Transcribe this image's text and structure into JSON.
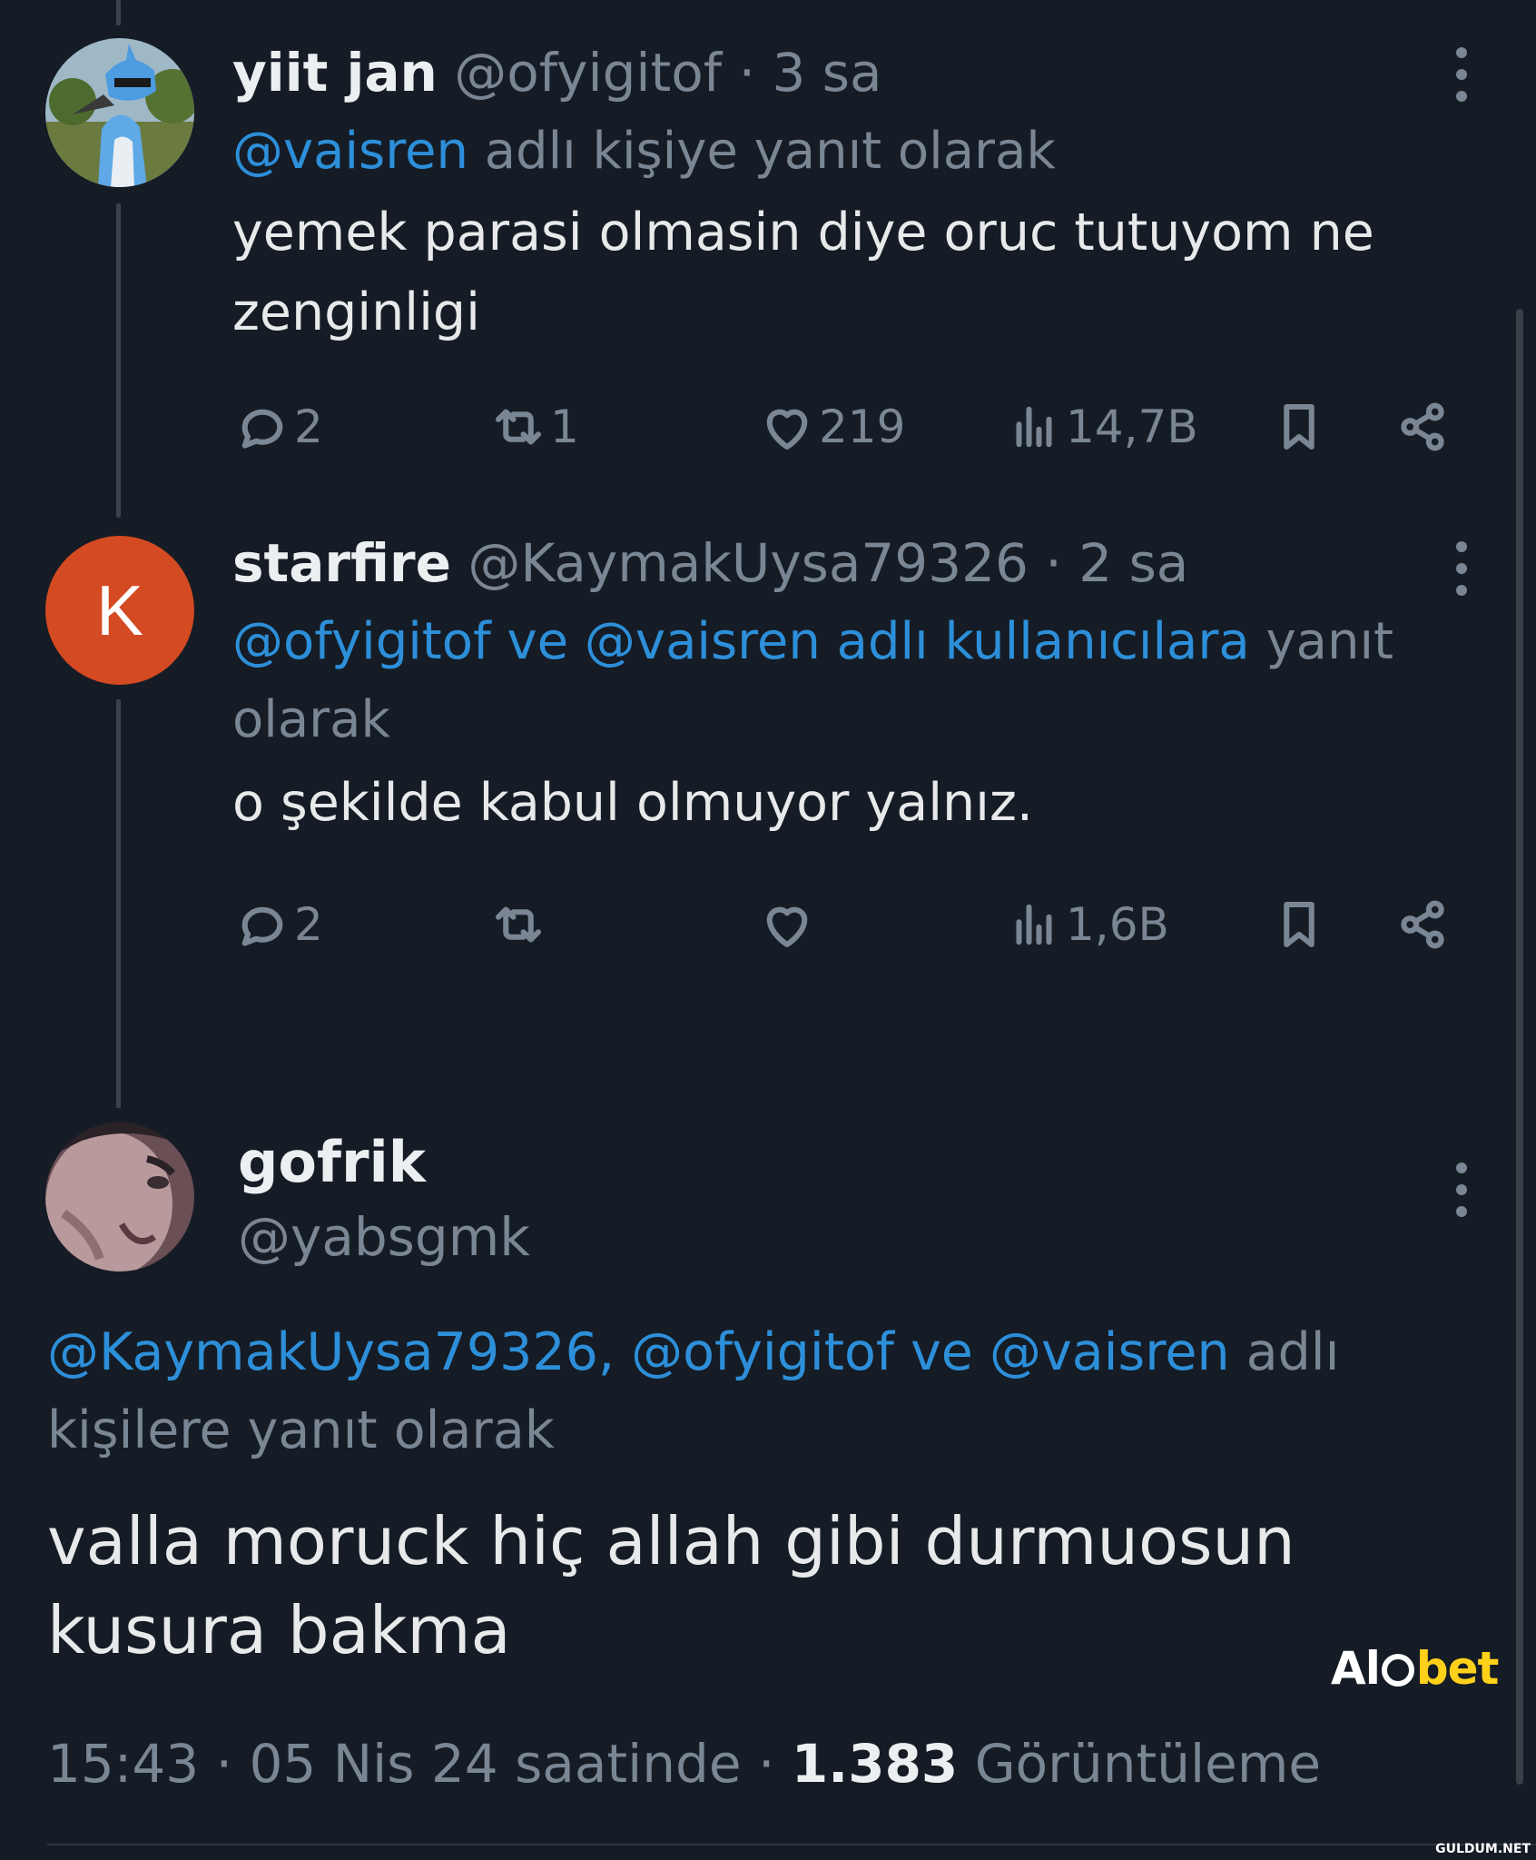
{
  "colors": {
    "background": "#151c25",
    "mention": "#2d8fd9",
    "muted": "#7a8694",
    "text": "#e7e9ea"
  },
  "tweets": [
    {
      "name": "yiit jan",
      "handle": "@ofyigitof",
      "sep": "·",
      "time": "3 sa",
      "reply_mention": "@vaisren",
      "reply_rest": " adlı kişiye yanıt olarak",
      "text": "yemek parasi olmasin diye oruc tutuyom ne zenginligi",
      "avatar_icon": "bird-character-avatar",
      "stats": {
        "replies": "2",
        "retweets": "1",
        "likes": "219",
        "views": "14,7B"
      }
    },
    {
      "name": "starfire",
      "handle": "@KaymakUysa79326",
      "sep": "·",
      "time": "2 sa",
      "avatar_letter": "K",
      "reply_mention": "@ofyigitof ve @vaisren adlı kullanıcılara",
      "reply_rest": " yanıt olarak",
      "text": "o şekilde kabul olmuyor yalnız.",
      "stats": {
        "replies": "2",
        "retweets": "",
        "likes": "",
        "views": "1,6B"
      }
    }
  ],
  "main_tweet": {
    "name": "gofrik",
    "handle": "@yabsgmk",
    "avatar_icon": "face-photo-avatar",
    "reply_mention": "@KaymakUysa79326, @ofyigitof ve @vaisren",
    "reply_rest": " adlı kişilere yanıt olarak",
    "text": "valla moruck hiç allah gibi durmuosun kusura bakma",
    "time": "15:43 · 05 Nis 24 saatinde · ",
    "views_count": "1.383",
    "views_label": " Görüntüleme"
  },
  "watermarks": {
    "logo_a": "Al",
    "logo_b": "bet",
    "site": "GULDUM.NET"
  }
}
